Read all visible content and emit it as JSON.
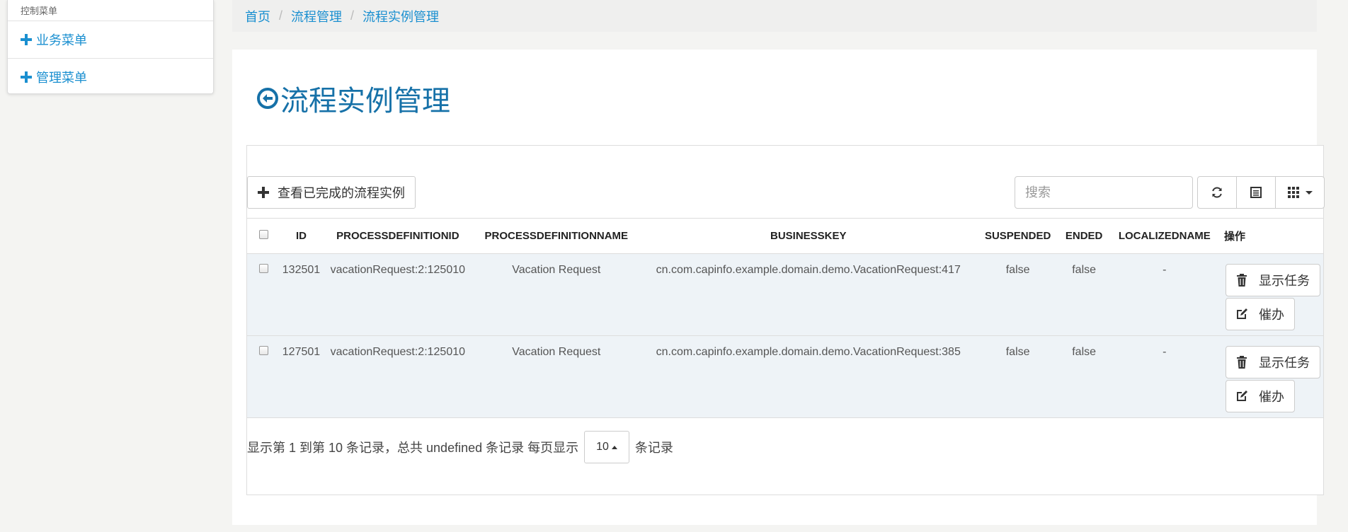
{
  "sidebar": {
    "header": "控制菜单",
    "items": [
      {
        "label": "业务菜单"
      },
      {
        "label": "管理菜单"
      }
    ]
  },
  "breadcrumb": {
    "items": [
      "首页",
      "流程管理",
      "流程实例管理"
    ],
    "separator": "/"
  },
  "page": {
    "title": "流程实例管理"
  },
  "toolbar": {
    "completed_label": "查看已完成的流程实例",
    "search_placeholder": "搜索",
    "icons": [
      "refresh-icon",
      "list-icon",
      "columns-icon"
    ]
  },
  "table": {
    "columns": [
      "ID",
      "PROCESSDEFINITIONID",
      "PROCESSDEFINITIONNAME",
      "BUSINESSKEY",
      "SUSPENDED",
      "ENDED",
      "LOCALIZEDNAME",
      "操作"
    ],
    "rows": [
      {
        "id": "132501",
        "processDefinitionId": "vacationRequest:2:125010",
        "processDefinitionName": "Vacation Request",
        "businessKey": "cn.com.capinfo.example.domain.demo.VacationRequest:417",
        "suspended": "false",
        "ended": "false",
        "localizedName": "-",
        "actions": [
          "显示任务",
          "催办"
        ]
      },
      {
        "id": "127501",
        "processDefinitionId": "vacationRequest:2:125010",
        "processDefinitionName": "Vacation Request",
        "businessKey": "cn.com.capinfo.example.domain.demo.VacationRequest:385",
        "suspended": "false",
        "ended": "false",
        "localizedName": "-",
        "actions": [
          "显示任务",
          "催办"
        ]
      }
    ]
  },
  "pagination": {
    "summary": "显示第 1 到第 10 条记录，总共 undefined 条记录 每页显示",
    "page_size": "10",
    "suffix": "条记录"
  },
  "colors": {
    "accent": "#1a8fd0",
    "title": "#1671a8",
    "row_bg": "#eef3f7"
  }
}
